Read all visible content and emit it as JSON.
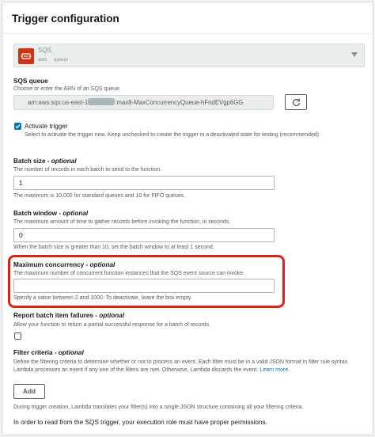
{
  "header": {
    "title": "Trigger configuration"
  },
  "source_select": {
    "title": "SQS",
    "tag_aws": "aws",
    "tag_queue": "queue"
  },
  "sqs_queue": {
    "label": "SQS queue",
    "description": "Choose or enter the ARN of an SQS queue.",
    "arn_prefix": "arn:aws:sqs:us-east-1",
    "arn_suffix": ":max8-MaxConcurrencyQueue-hFndEVgp6GG"
  },
  "activate_trigger": {
    "label": "Activate trigger",
    "description": "Select to activate the trigger now. Keep unchecked to create the trigger in a deactivated state for testing (recommended).",
    "checked": true
  },
  "batch_size": {
    "label": "Batch size - ",
    "optional": "optional",
    "description": "The number of records in each batch to send to the function.",
    "value": "1",
    "constraint": "The maximum is 10,000 for standard queues and 10 for FIFO queues."
  },
  "batch_window": {
    "label": "Batch window - ",
    "optional": "optional",
    "description": "The maximum amount of time to gather records before invoking the function, in seconds.",
    "value": "0",
    "constraint": "When the batch size is greater than 10, set the batch window to at least 1 second."
  },
  "max_concurrency": {
    "label": "Maximum concurrency - ",
    "optional": "optional",
    "description": "The maximum number of concurrent function instances that the SQS event source can invoke.",
    "value": "",
    "constraint": "Specify a value between 2 and 1000. To deactivate, leave the box empty.",
    "highlight_color": "#e0211b"
  },
  "report_failures": {
    "label": "Report batch item failures - ",
    "optional": "optional",
    "description": "Allow your function to return a partial successful response for a batch of records.",
    "checked": false
  },
  "filter_criteria": {
    "label": "Filter criteria - ",
    "optional": "optional",
    "description": "Define the filtering criteria to determine whether or not to process an event. Each filter must be in a valid JSON format in filter rule syntax. Lambda processes an event if any one of the filters are met. Otherwise, Lambda discards the event.",
    "learn_more": "Learn more.",
    "add_label": "Add",
    "note": "During trigger creation, Lambda translates your filter(s) into a single JSON structure containing all your filtering criteria."
  },
  "permissions_note": "In order to read from the SQS trigger, your execution role must have proper permissions.",
  "colors": {
    "accent_blue": "#0073bb",
    "sqs_icon": "#d13212",
    "highlight": "#e0211b"
  }
}
